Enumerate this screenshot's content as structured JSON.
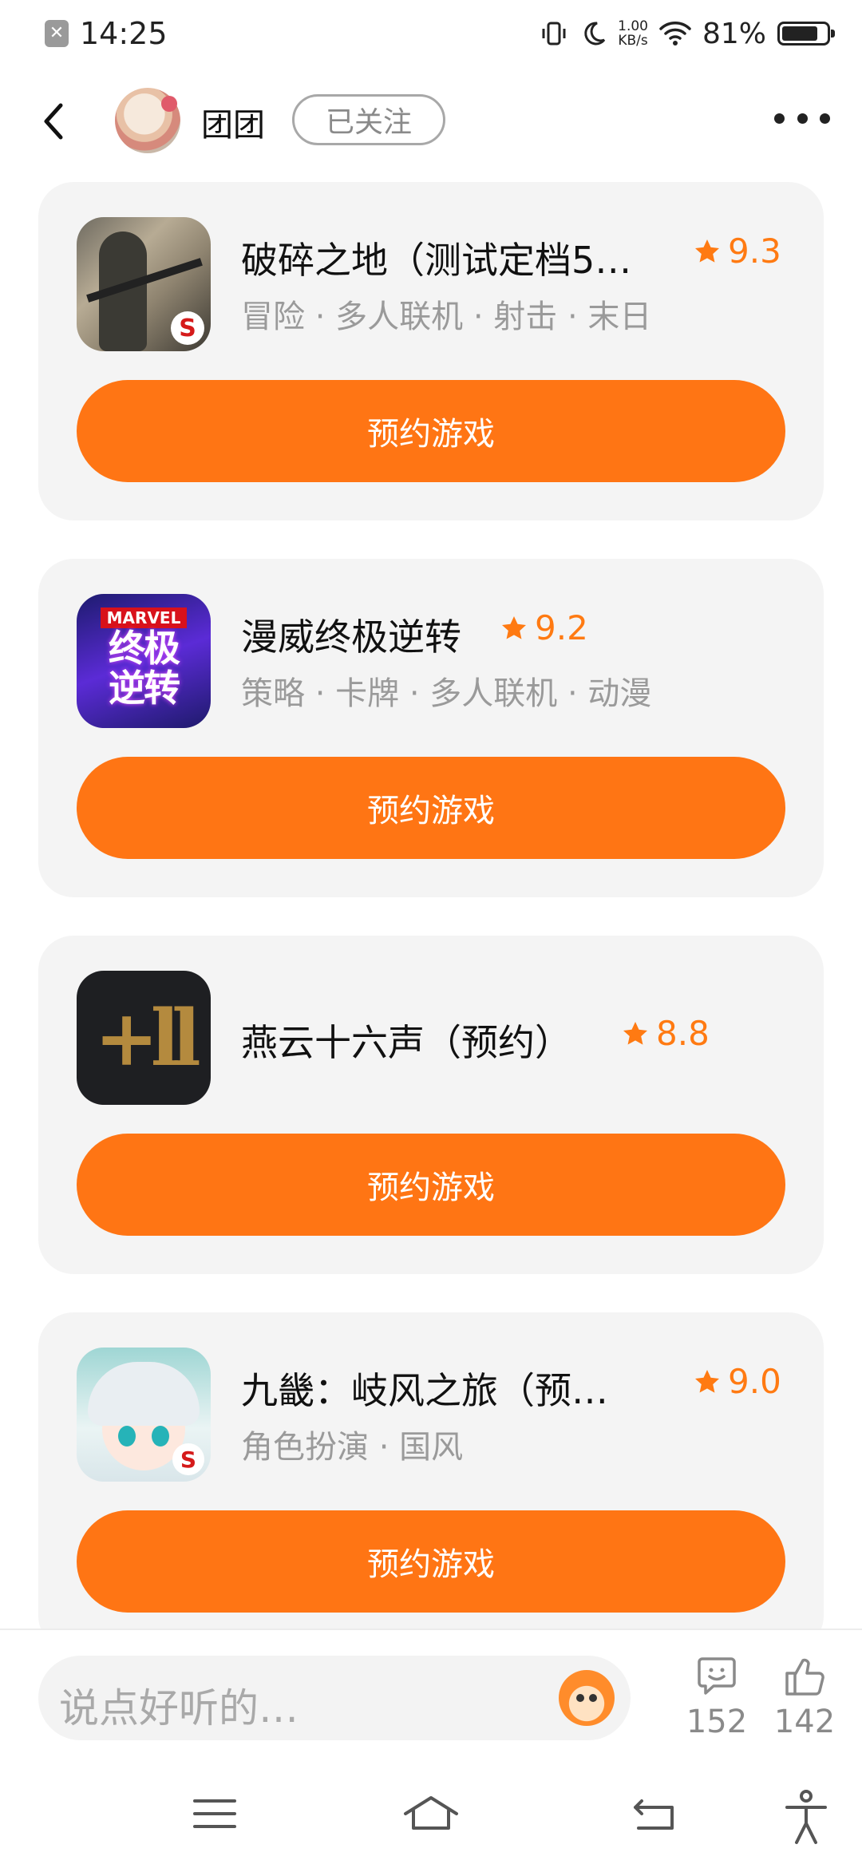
{
  "status_bar": {
    "time": "14:25",
    "speed_value": "1.00",
    "speed_unit": "KB/s",
    "battery": "81%",
    "battery_level": 0.81,
    "icons": [
      "notification-icon",
      "vibrate-icon",
      "moon-icon",
      "wifi-icon",
      "battery-icon"
    ]
  },
  "header": {
    "user_name": "团团",
    "follow_label": "已关注"
  },
  "games": [
    {
      "name": "破碎之地（测试定档5…",
      "rating": "9.3",
      "tags": "冒险 · 多人联机 · 射击 · 末日",
      "button": "预约游戏"
    },
    {
      "name": "漫威终极逆转",
      "rating": "9.2",
      "tags": "策略 · 卡牌 · 多人联机 · 动漫",
      "button": "预约游戏",
      "icon_text_top": "MARVEL",
      "icon_text_1": "终极",
      "icon_text_2": "逆转"
    },
    {
      "name": "燕云十六声（预约）",
      "rating": "8.8",
      "tags": "",
      "button": "预约游戏"
    },
    {
      "name": "九畿：岐风之旅（预…",
      "rating": "9.0",
      "tags": "角色扮演 · 国风",
      "button": "预约游戏"
    }
  ],
  "bottom_bar": {
    "comment_placeholder": "说点好听的…",
    "comment_count": "152",
    "like_count": "142"
  },
  "colors": {
    "accent": "#ff7514",
    "rating": "#ff7a12",
    "card_bg": "#f4f4f4"
  }
}
